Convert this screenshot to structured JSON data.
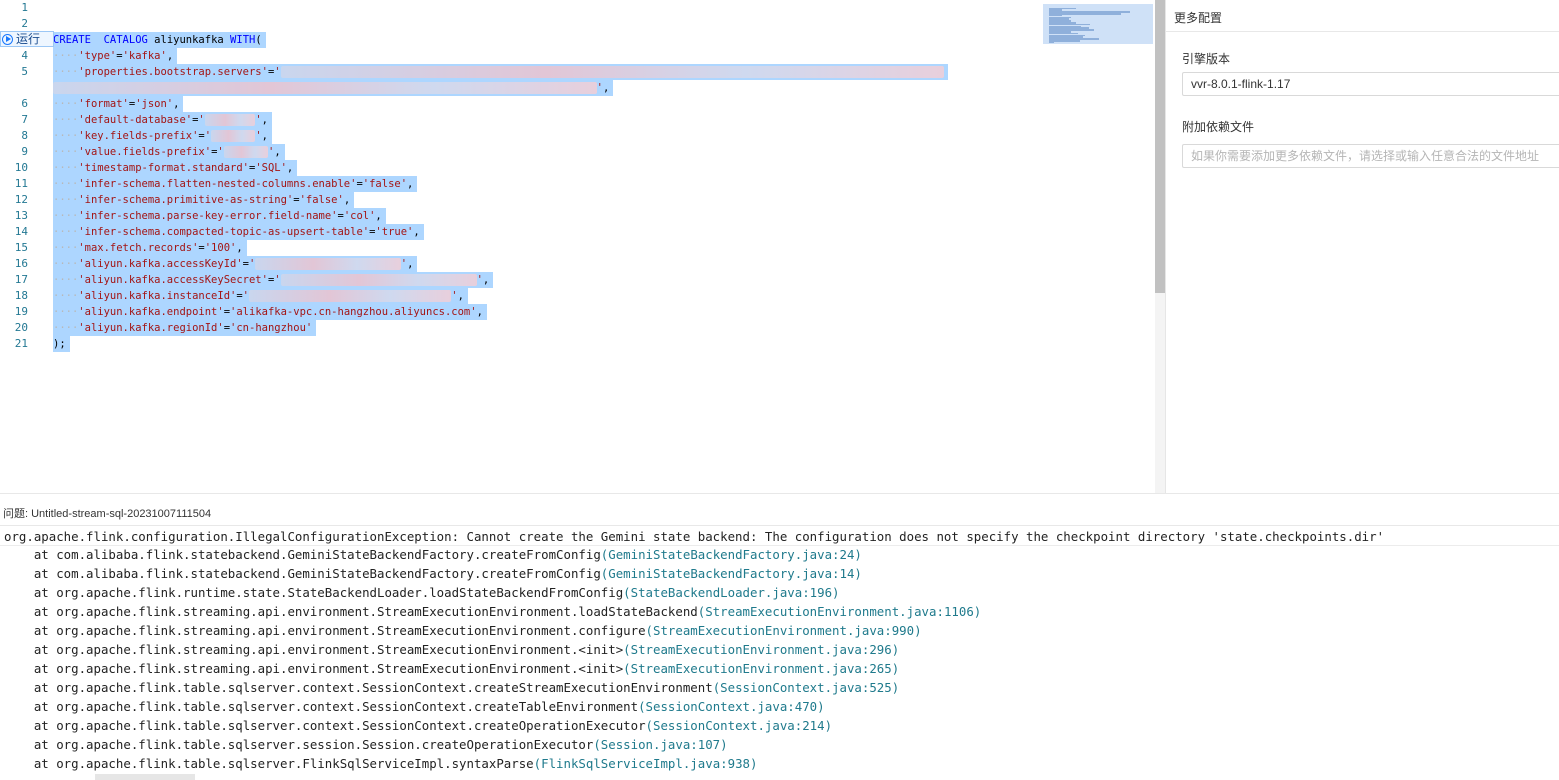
{
  "editor": {
    "run_label": "运行",
    "lines": [
      {
        "n": "1",
        "text": "",
        "sel": false
      },
      {
        "n": "2",
        "text": "",
        "sel": false
      },
      {
        "n": "3",
        "text": "CREATE  CATALOG aliyunkafka WITH(",
        "sel": true
      },
      {
        "n": "4",
        "text": "'type'='kafka',",
        "sel": true,
        "indent": true
      },
      {
        "n": "5",
        "text": "'properties.bootstrap.servers'='",
        "sel": true,
        "indent": true,
        "blur": "xxxxxxxxxxxxxxxxxxxxxxxxxxxxxxxxxxxxxxxxxxxxxxxxxxxxxxxxxxxxxxxxxxxxxxxxxxxxxxxxxxxxxxxxxxxxxxxxxxxxxxxxx"
      },
      {
        "n": "",
        "text": "",
        "sel": true,
        "blur": "xxxxxxxxxxxxxxxxxxxxxxxxxxxxxxxxxxxxxxxxxxxxxxxxxxxxxxxxxxxxxxxxxxxxxxxxxxxxxxxxxxxxxx",
        "tail": "',"
      },
      {
        "n": "6",
        "text": "'format'='json',",
        "sel": true,
        "indent": true
      },
      {
        "n": "7",
        "text": "'default-database'='",
        "sel": true,
        "indent": true,
        "blur": "xxxxxxxx",
        "tail": "',"
      },
      {
        "n": "8",
        "text": "'key.fields-prefix'='",
        "sel": true,
        "indent": true,
        "blur": "xxxxxxx",
        "tail": "',"
      },
      {
        "n": "9",
        "text": "'value.fields-prefix'='",
        "sel": true,
        "indent": true,
        "blur": "xxxxxxx",
        "tail": "',"
      },
      {
        "n": "10",
        "text": "'timestamp-format.standard'='SQL',",
        "sel": true,
        "indent": true
      },
      {
        "n": "11",
        "text": "'infer-schema.flatten-nested-columns.enable'='false',",
        "sel": true,
        "indent": true
      },
      {
        "n": "12",
        "text": "'infer-schema.primitive-as-string'='false',",
        "sel": true,
        "indent": true
      },
      {
        "n": "13",
        "text": "'infer-schema.parse-key-error.field-name'='col',",
        "sel": true,
        "indent": true
      },
      {
        "n": "14",
        "text": "'infer-schema.compacted-topic-as-upsert-table'='true',",
        "sel": true,
        "indent": true
      },
      {
        "n": "15",
        "text": "'max.fetch.records'='100',",
        "sel": true,
        "indent": true
      },
      {
        "n": "16",
        "text": "'aliyun.kafka.accessKeyId'='",
        "sel": true,
        "indent": true,
        "blur": "xxxxxxxxxxxxxxxxxxxxxxx",
        "tail": "',"
      },
      {
        "n": "17",
        "text": "'aliyun.kafka.accessKeySecret'='",
        "sel": true,
        "indent": true,
        "blur": "xxxxxxxxxxxxxxxxxxxxxxxxxxxxxxx",
        "tail": "',"
      },
      {
        "n": "18",
        "text": "'aliyun.kafka.instanceId'='",
        "sel": true,
        "indent": true,
        "blur": "xxxxxxxxxxxxxxxxxxxxxxxxxxxxxxxx",
        "tail": "',"
      },
      {
        "n": "19",
        "text": "'aliyun.kafka.endpoint'='alikafka-vpc.cn-hangzhou.aliyuncs.com',",
        "sel": true,
        "indent": true
      },
      {
        "n": "20",
        "text": "'aliyun.kafka.regionId'='cn-hangzhou'",
        "sel": true,
        "indent": true
      },
      {
        "n": "21",
        "text": ");",
        "sel": true
      }
    ]
  },
  "config": {
    "title": "更多配置",
    "engine_label": "引擎版本",
    "engine_value": "vvr-8.0.1-flink-1.17",
    "deps_label": "附加依赖文件",
    "deps_placeholder": "如果你需要添加更多依赖文件，请选择或输入任意合法的文件地址"
  },
  "problems": {
    "title": "问题: Untitled-stream-sql-20231007111504",
    "error": "org.apache.flink.configuration.IllegalConfigurationException: Cannot create the Gemini state backend: The configuration does not specify the checkpoint directory 'state.checkpoints.dir'",
    "trace": [
      {
        "call": "    at com.alibaba.flink.statebackend.GeminiStateBackendFactory.createFromConfig",
        "loc": "(GeminiStateBackendFactory.java:24)"
      },
      {
        "call": "    at com.alibaba.flink.statebackend.GeminiStateBackendFactory.createFromConfig",
        "loc": "(GeminiStateBackendFactory.java:14)"
      },
      {
        "call": "    at org.apache.flink.runtime.state.StateBackendLoader.loadStateBackendFromConfig",
        "loc": "(StateBackendLoader.java:196)"
      },
      {
        "call": "    at org.apache.flink.streaming.api.environment.StreamExecutionEnvironment.loadStateBackend",
        "loc": "(StreamExecutionEnvironment.java:1106)"
      },
      {
        "call": "    at org.apache.flink.streaming.api.environment.StreamExecutionEnvironment.configure",
        "loc": "(StreamExecutionEnvironment.java:990)"
      },
      {
        "call": "    at org.apache.flink.streaming.api.environment.StreamExecutionEnvironment.<init>",
        "loc": "(StreamExecutionEnvironment.java:296)"
      },
      {
        "call": "    at org.apache.flink.streaming.api.environment.StreamExecutionEnvironment.<init>",
        "loc": "(StreamExecutionEnvironment.java:265)"
      },
      {
        "call": "    at org.apache.flink.table.sqlserver.context.SessionContext.createStreamExecutionEnvironment",
        "loc": "(SessionContext.java:525)"
      },
      {
        "call": "    at org.apache.flink.table.sqlserver.context.SessionContext.createTableEnvironment",
        "loc": "(SessionContext.java:470)"
      },
      {
        "call": "    at org.apache.flink.table.sqlserver.context.SessionContext.createOperationExecutor",
        "loc": "(SessionContext.java:214)"
      },
      {
        "call": "    at org.apache.flink.table.sqlserver.session.Session.createOperationExecutor",
        "loc": "(Session.java:107)"
      },
      {
        "call": "    at org.apache.flink.table.sqlserver.FlinkSqlServiceImpl.syntaxParse",
        "loc": "(FlinkSqlServiceImpl.java:938)"
      }
    ]
  }
}
